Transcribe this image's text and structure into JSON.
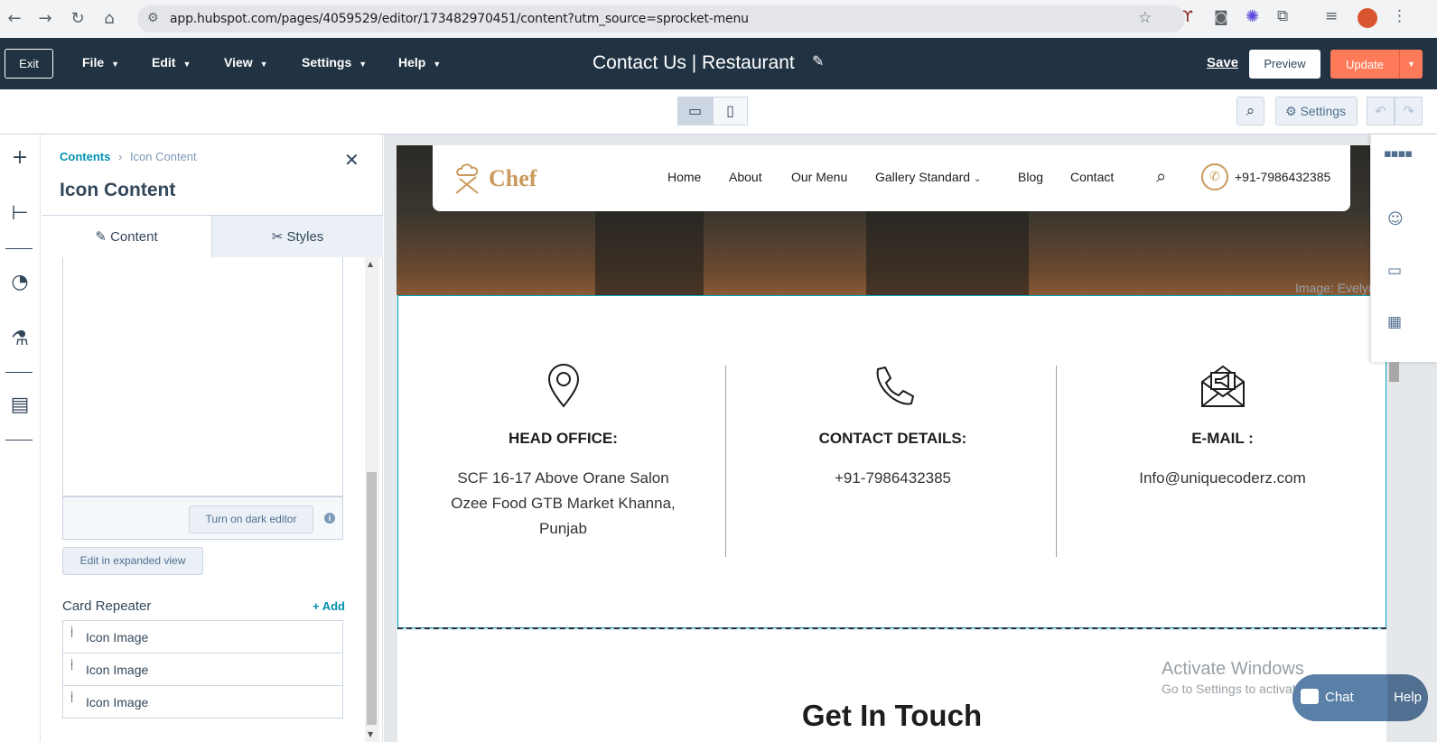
{
  "browser": {
    "url": "app.hubspot.com/pages/4059529/editor/173482970451/content?utm_source=sprocket-menu",
    "icons": [
      "back-arrow-icon",
      "forward-arrow-icon",
      "reload-icon",
      "home-icon",
      "site-info-icon",
      "star-icon",
      "extension-icon",
      "camera-icon",
      "gear-extension-icon",
      "puzzle-icon",
      "media-icon",
      "avatar",
      "kebab-menu-icon"
    ]
  },
  "header": {
    "exit_label": "Exit",
    "menus": [
      "File",
      "Edit",
      "View",
      "Settings",
      "Help"
    ],
    "page_title": "Contact Us | Restaurant",
    "save_label": "Save",
    "preview_label": "Preview",
    "update_label": "Update",
    "accent_color": "#ff7a59",
    "bg_color": "#213343"
  },
  "toolbar": {
    "settings_label": "Settings"
  },
  "panel": {
    "breadcrumb_root": "Contents",
    "breadcrumb_current": "Icon Content",
    "title": "Icon Content",
    "tab_content": "Content",
    "tab_styles": "Styles",
    "dark_editor_label": "Turn on dark editor",
    "expanded_view_label": "Edit in expanded view",
    "card_repeater_label": "Card Repeater",
    "add_label": "+ Add",
    "card_items": [
      "Icon Image",
      "Icon Image",
      "Icon Image"
    ]
  },
  "site": {
    "logo_text": "Chef",
    "nav": [
      "Home",
      "About",
      "Our Menu",
      "Gallery Standard",
      "Blog",
      "Contact"
    ],
    "phone": "+91-7986432385",
    "hero_credit": "Image: Evelyn",
    "columns": [
      {
        "heading": "HEAD OFFICE:",
        "lines": [
          "SCF 16-17 Above Orane Salon",
          "Ozee Food GTB Market Khanna,",
          "Punjab"
        ]
      },
      {
        "heading": "CONTACT DETAILS:",
        "lines": [
          "+91-7986432385"
        ]
      },
      {
        "heading": "E-MAIL :",
        "lines": [
          "Info@uniquecoderz.com"
        ]
      }
    ],
    "get_in_touch": "Get In Touch",
    "brand_color": "#c99a5b"
  },
  "os": {
    "activate_title": "Activate Windows",
    "activate_sub": "Go to Settings to activate Windows."
  },
  "chat": {
    "chat_label": "Chat",
    "help_label": "Help"
  }
}
